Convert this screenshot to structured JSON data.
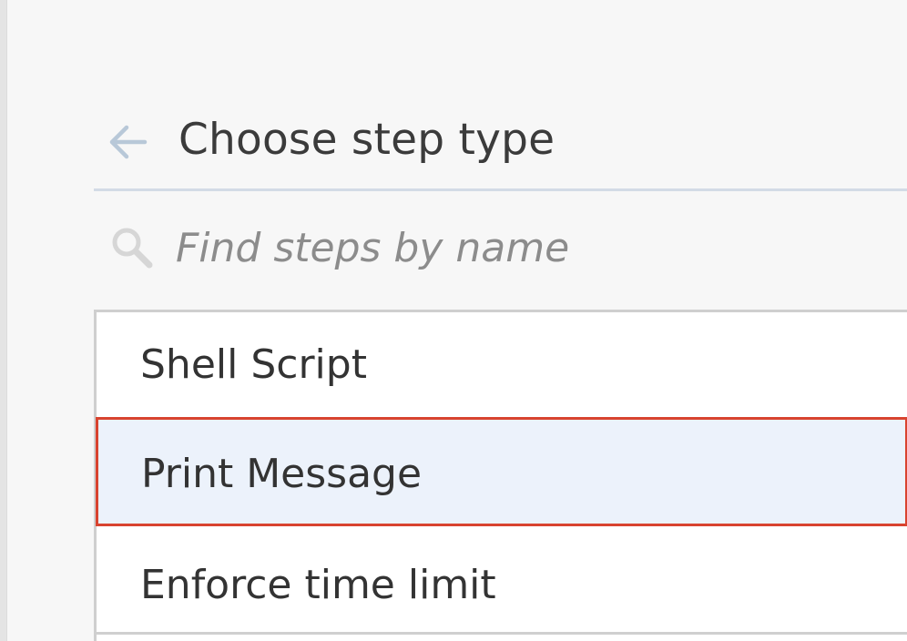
{
  "header": {
    "title": "Choose step type",
    "back_icon": "arrow-left-icon"
  },
  "search": {
    "placeholder": "Find steps by name",
    "value": "",
    "icon": "search-icon"
  },
  "step_types": [
    {
      "label": "Shell Script",
      "selected": false
    },
    {
      "label": "Print Message",
      "selected": true
    },
    {
      "label": "Enforce time limit",
      "selected": false
    }
  ],
  "colors": {
    "selected_background": "#ecf2fb",
    "selected_border": "#d8432f",
    "divider": "#d3dbe6",
    "icon": "#b8c8d8"
  }
}
